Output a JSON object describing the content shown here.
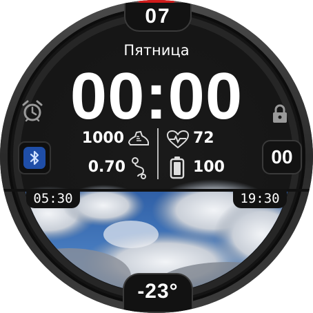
{
  "top": {
    "day_number": "07"
  },
  "header": {
    "weekday": "Пятница"
  },
  "time": {
    "value": "00:00"
  },
  "right_complication": {
    "value": "00"
  },
  "stats": {
    "steps": "1000",
    "distance": "0.70",
    "heart_rate": "72",
    "battery": "100"
  },
  "sun": {
    "sunrise": "05:30",
    "sunset": "19:30"
  },
  "weather": {
    "temperature": "-23°"
  },
  "icons": {
    "alarm": "alarm-clock-icon",
    "lock": "lock-icon",
    "bluetooth": "bluetooth-icon",
    "steps": "shoe-icon",
    "distance": "route-icon",
    "heart": "heart-pulse-icon",
    "battery": "battery-icon"
  },
  "colors": {
    "accent_red": "#d11a1a",
    "bluetooth_bg": "#1f4ea8",
    "ring": "#2a2a2a"
  }
}
